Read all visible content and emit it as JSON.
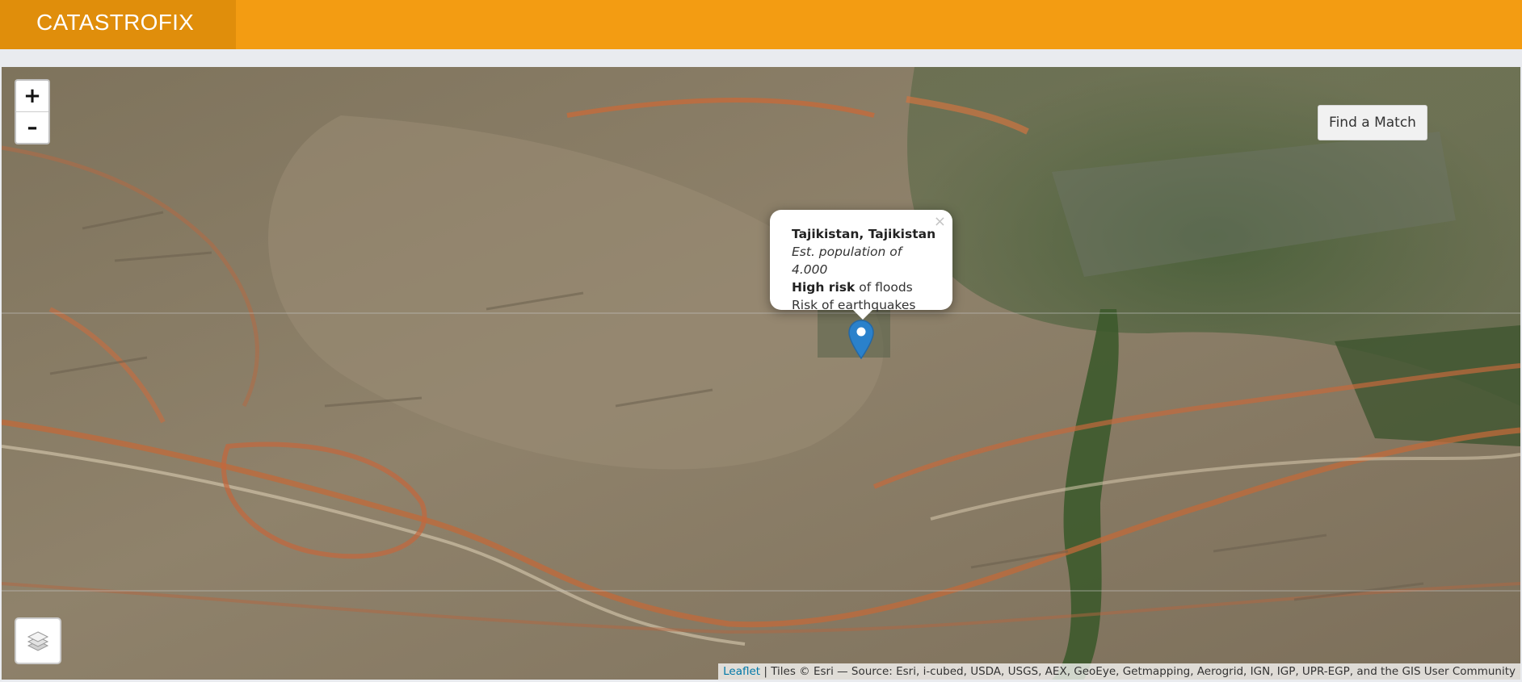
{
  "header": {
    "brand": "CATASTROFIX",
    "brand_color": "#e08e0b",
    "bar_color": "#f39c12"
  },
  "map": {
    "zoom_in_label": "+",
    "zoom_out_label": "–",
    "find_match_label": "Find a Match",
    "popup": {
      "close_label": "×",
      "title": "Tajikistan, Tajikistan",
      "population": "Est. population of 4.000",
      "risk_strong": "High risk",
      "risk_rest": " of floods",
      "risk2": "Risk of earthquakes"
    },
    "marker_icon": "map-pin-icon",
    "marker_color": "#2a81cb",
    "layers_icon": "layers-icon",
    "attribution": {
      "link": "Leaflet",
      "text": " | Tiles © Esri — Source: Esri, i-cubed, USDA, USGS, AEX, GeoEye, Getmapping, Aerogrid, IGN, IGP, UPR-EGP, and the GIS User Community"
    }
  }
}
